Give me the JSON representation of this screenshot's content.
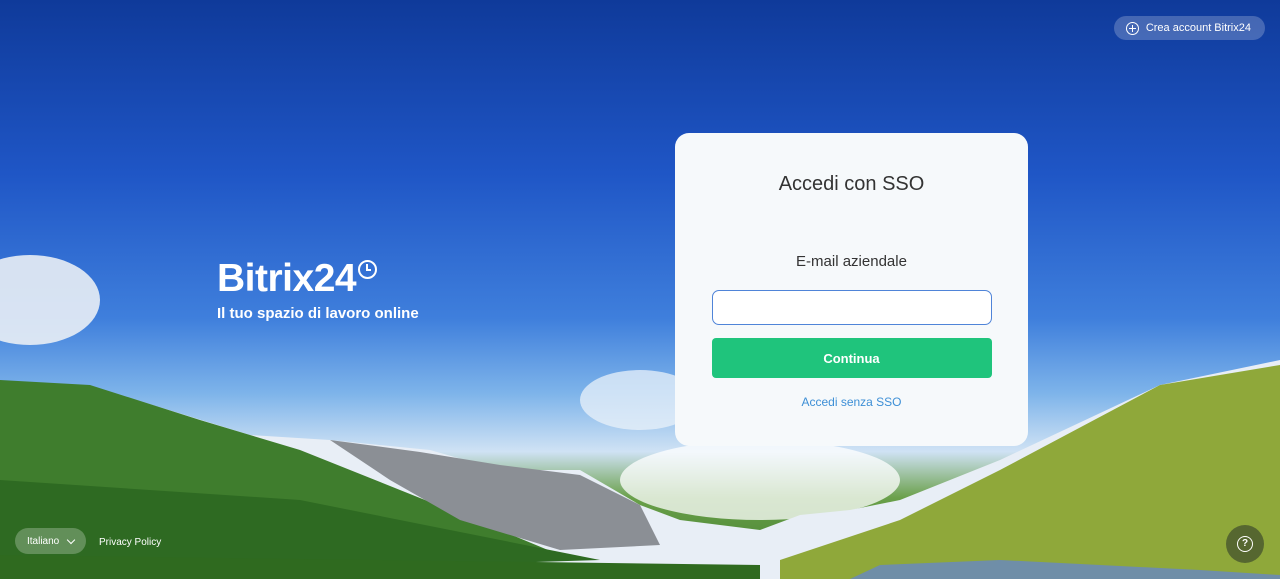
{
  "header": {
    "create_account_label": "Crea account Bitrix24"
  },
  "brand": {
    "logo_text": "Bitrix24",
    "tagline": "Il tuo spazio di lavoro online"
  },
  "login": {
    "title": "Accedi con SSO",
    "email_label": "E-mail aziendale",
    "email_value": "",
    "continue_label": "Continua",
    "no_sso_label": "Accedi senza SSO"
  },
  "footer": {
    "language": "Italiano",
    "privacy_label": "Privacy Policy",
    "help_glyph": "?"
  },
  "colors": {
    "accent_green": "#1fc47c",
    "link_blue": "#3d8fd6",
    "input_border": "#4f84d8"
  },
  "icons": [
    "plus-circle-icon",
    "clock-icon",
    "chevron-down-icon",
    "help-icon"
  ]
}
